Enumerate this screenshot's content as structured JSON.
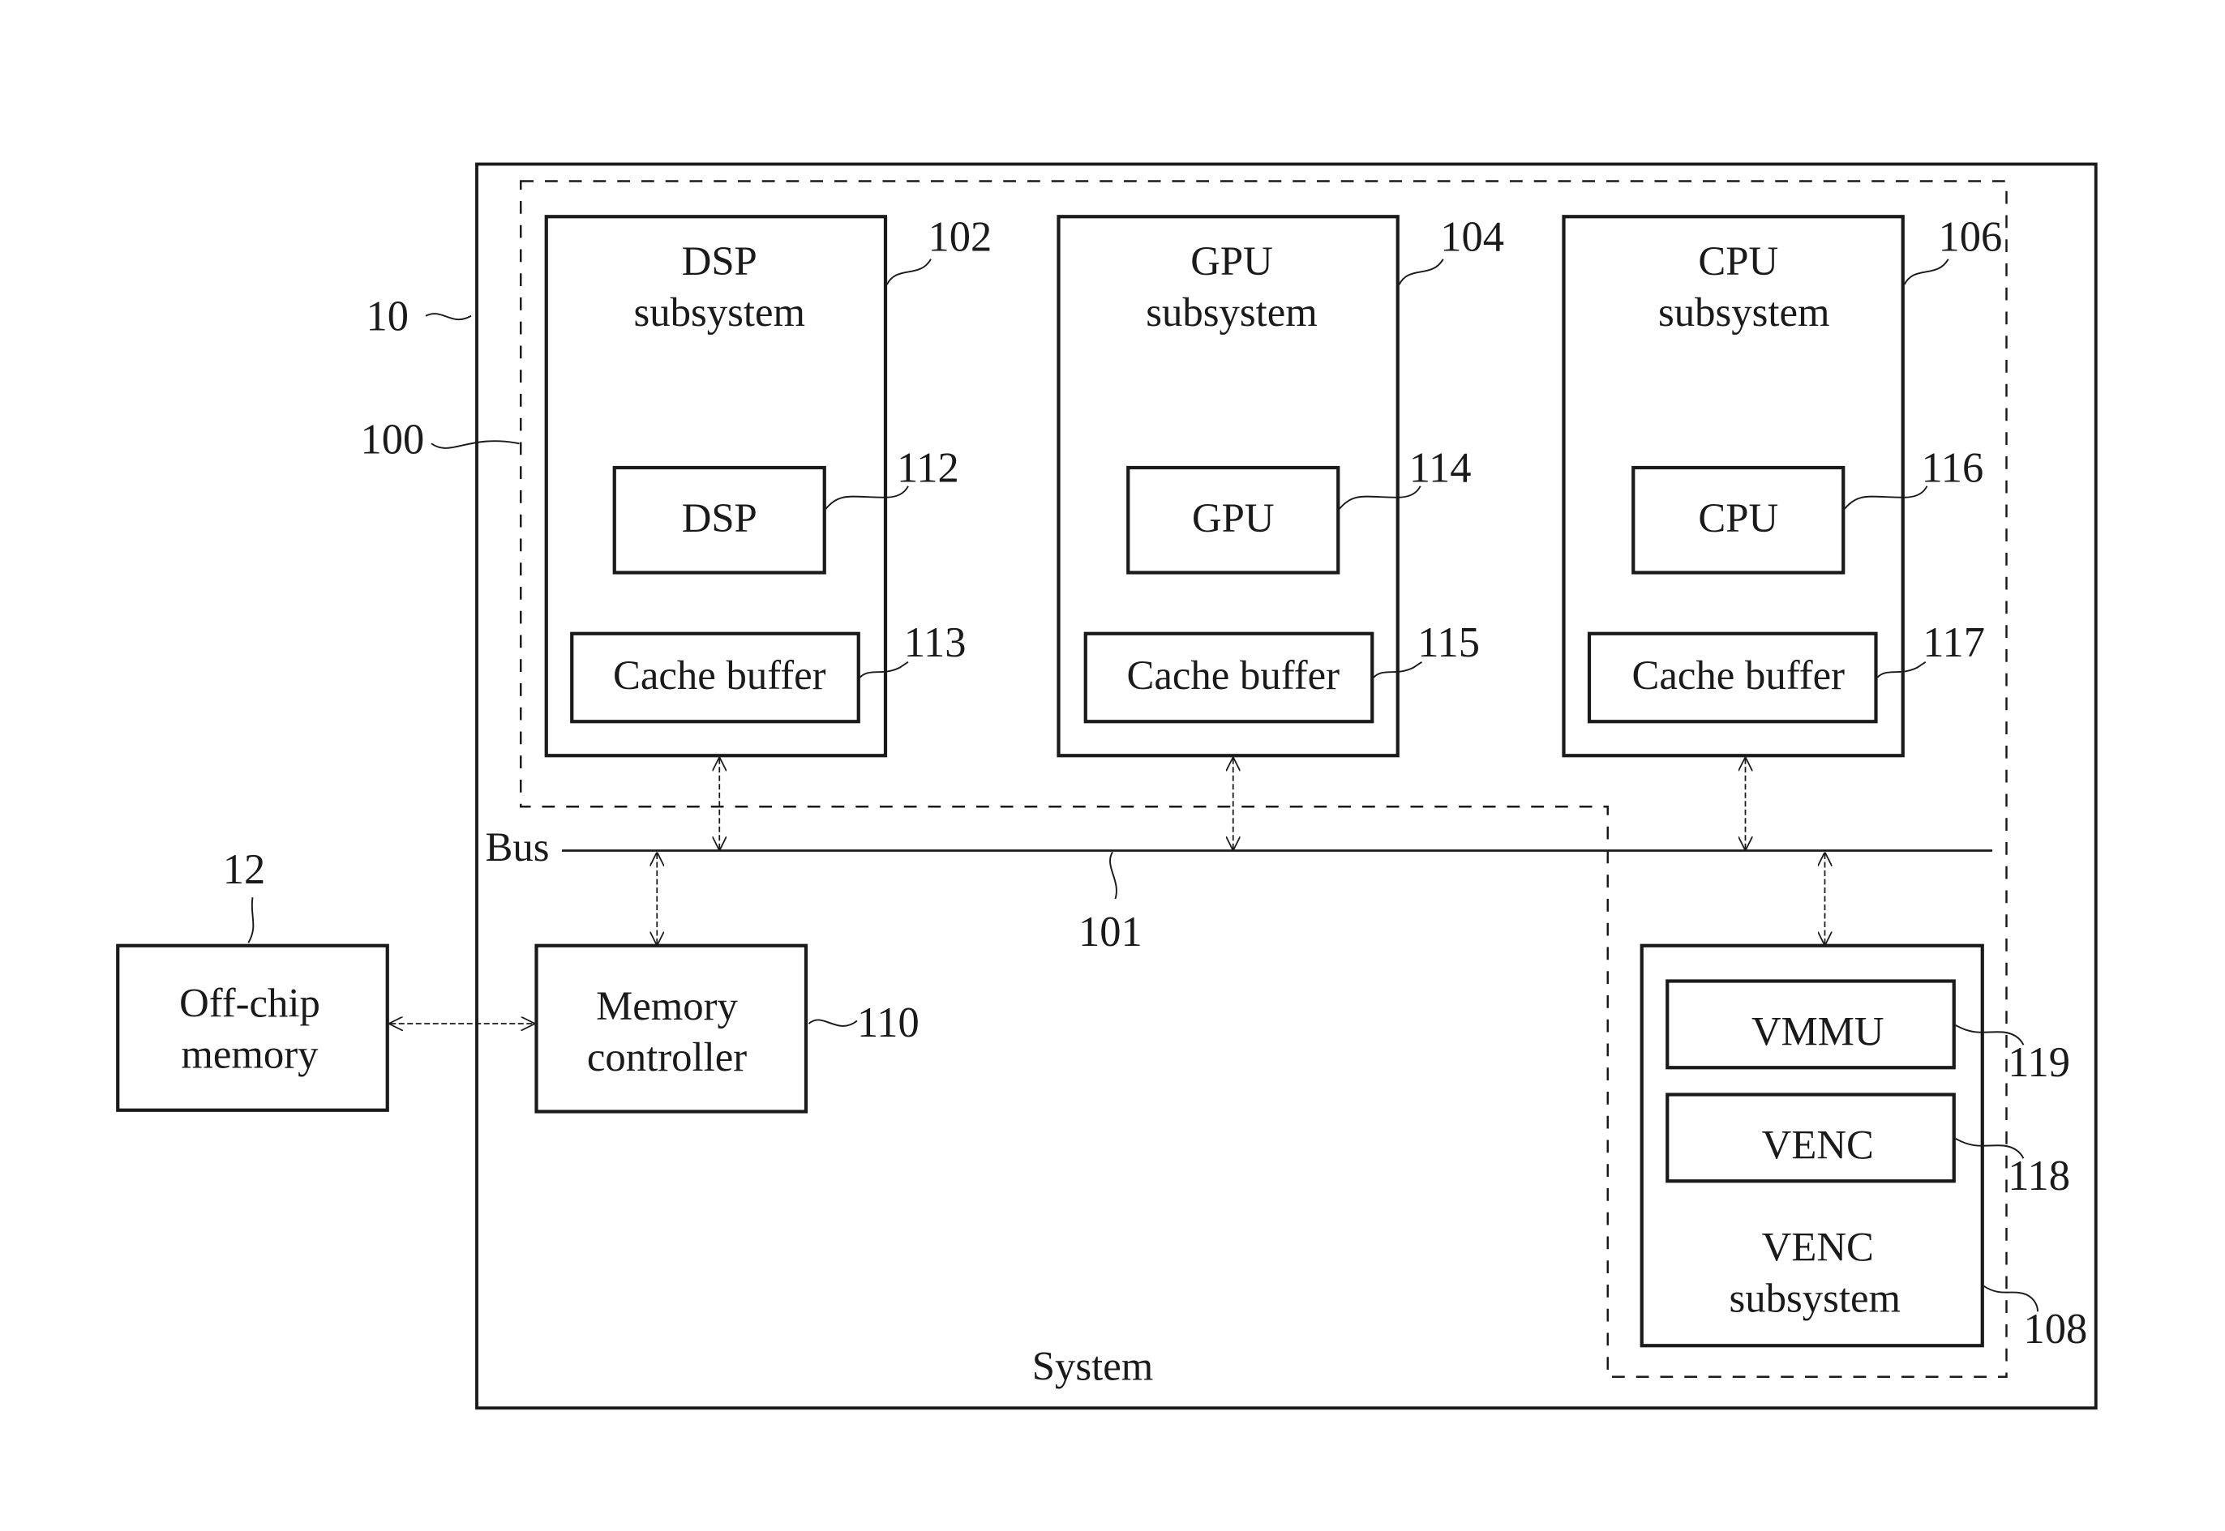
{
  "figure": {
    "system_label": "System",
    "system_ref": "10",
    "cluster_ref": "100",
    "bus": {
      "label": "Bus",
      "ref": "101"
    },
    "off_chip_memory": {
      "line1": "Off-chip",
      "line2": "memory",
      "ref": "12"
    },
    "memory_controller": {
      "line1": "Memory",
      "line2": "controller",
      "ref": "110"
    },
    "subsystems": [
      {
        "name": "DSP",
        "title": "DSP",
        "subtitle": "subsystem",
        "ref": "102",
        "core": {
          "label": "DSP",
          "ref": "112"
        },
        "cache": {
          "label": "Cache buffer",
          "ref": "113"
        }
      },
      {
        "name": "GPU",
        "title": "GPU",
        "subtitle": "subsystem",
        "ref": "104",
        "core": {
          "label": "GPU",
          "ref": "114"
        },
        "cache": {
          "label": "Cache buffer",
          "ref": "115"
        }
      },
      {
        "name": "CPU",
        "title": "CPU",
        "subtitle": "subsystem",
        "ref": "106",
        "core": {
          "label": "CPU",
          "ref": "116"
        },
        "cache": {
          "label": "Cache buffer",
          "ref": "117"
        }
      }
    ],
    "venc_subsystem": {
      "title": "VENC",
      "subtitle": "subsystem",
      "ref": "108",
      "vmmu": {
        "label": "VMMU",
        "ref": "119"
      },
      "venc": {
        "label": "VENC",
        "ref": "118"
      }
    }
  }
}
